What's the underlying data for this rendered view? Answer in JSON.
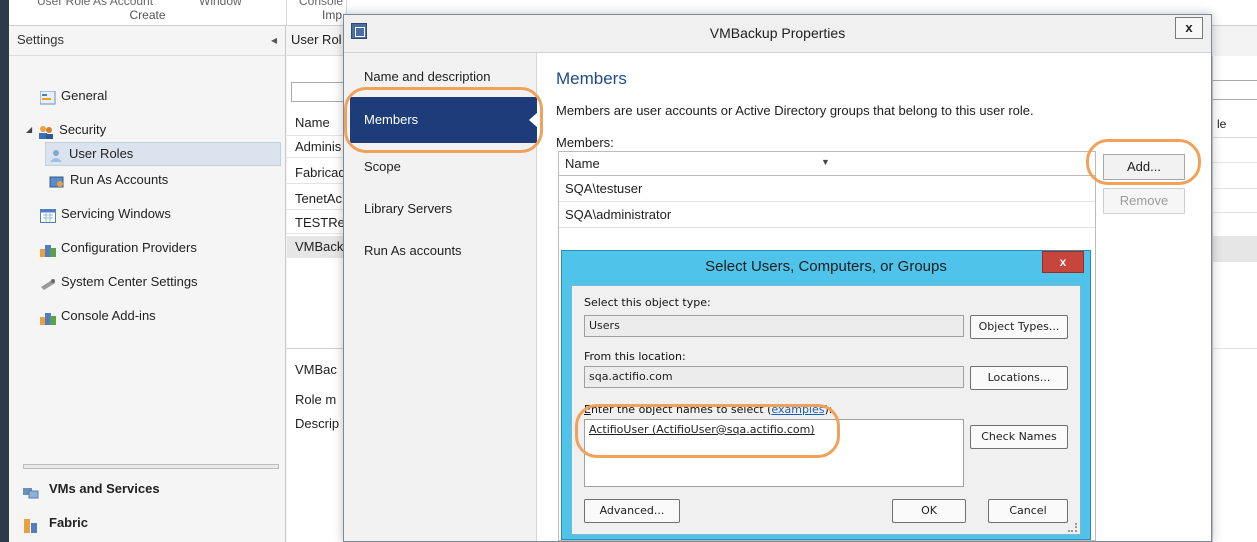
{
  "ribbon": {
    "groups": [
      {
        "cut_text": "User Role  As Account",
        "cut_text2": "Window",
        "caption": "Create"
      },
      {
        "cut_text": "Console",
        "caption": "Imp"
      }
    ]
  },
  "nav": {
    "title": "Settings",
    "collapse_glyph": "◂",
    "items": [
      {
        "label": "General",
        "icon": "general-icon"
      },
      {
        "label": "Security",
        "icon": "security-icon",
        "expand_glyph": "◢"
      },
      {
        "label": "User Roles",
        "icon": "user-roles-icon",
        "selected": true
      },
      {
        "label": "Run As Accounts",
        "icon": "run-as-accounts-icon"
      },
      {
        "label": "Servicing Windows",
        "icon": "servicing-windows-icon"
      },
      {
        "label": "Configuration Providers",
        "icon": "configuration-providers-icon"
      },
      {
        "label": "System Center Settings",
        "icon": "system-center-settings-icon"
      },
      {
        "label": "Console Add-ins",
        "icon": "console-addins-icon"
      }
    ],
    "workspaces": [
      {
        "label": "VMs and Services",
        "icon": "vms-services-icon"
      },
      {
        "label": "Fabric",
        "icon": "fabric-icon"
      }
    ]
  },
  "list_pane": {
    "header": "User Rol",
    "columns": [
      "Name"
    ],
    "rows": [
      "Adminis",
      "Fabricad",
      "TenetAc",
      "TESTRea",
      "VMBack"
    ],
    "detail_title": "VMBac",
    "detail_lines": [
      "Role m",
      "Descrip"
    ]
  },
  "right_pane": {
    "header_fragment": "le"
  },
  "dialog": {
    "title": "VMBackup Properties",
    "close_label": "x",
    "sidebar": [
      "Name and description",
      "Members",
      "Scope",
      "Library Servers",
      "Run As accounts"
    ],
    "active_page": "Members",
    "members": {
      "heading": "Members",
      "description": "Members are user accounts or Active Directory groups that belong to this user role.",
      "list_label": "Members:",
      "column": "Name",
      "rows": [
        "SQA\\testuser",
        "SQA\\administrator"
      ],
      "add_label": "Add...",
      "remove_label": "Remove"
    }
  },
  "select_dialog": {
    "title": "Select Users, Computers, or Groups",
    "close_label": "x",
    "object_type_label": "Select this object type:",
    "object_type_value": "Users",
    "object_types_button": "Object Types...",
    "location_label": "From this location:",
    "location_value": "sqa.actifio.com",
    "locations_button": "Locations...",
    "names_label_prefix": "nter the object names to select (",
    "names_label_accel": "E",
    "names_label_link": "examples",
    "names_label_suffix": "):",
    "names_value": "ActifioUser (ActifioUser@sqa.actifio.com)",
    "check_names_button": "Check Names",
    "advanced_button": "Advanced...",
    "ok_button": "OK",
    "cancel_button": "Cancel"
  },
  "colors": {
    "accent_orange": "#f0a15a",
    "active_nav": "#1f3c7a",
    "select_frame": "#4fc3ea",
    "close_red": "#c7453b"
  }
}
